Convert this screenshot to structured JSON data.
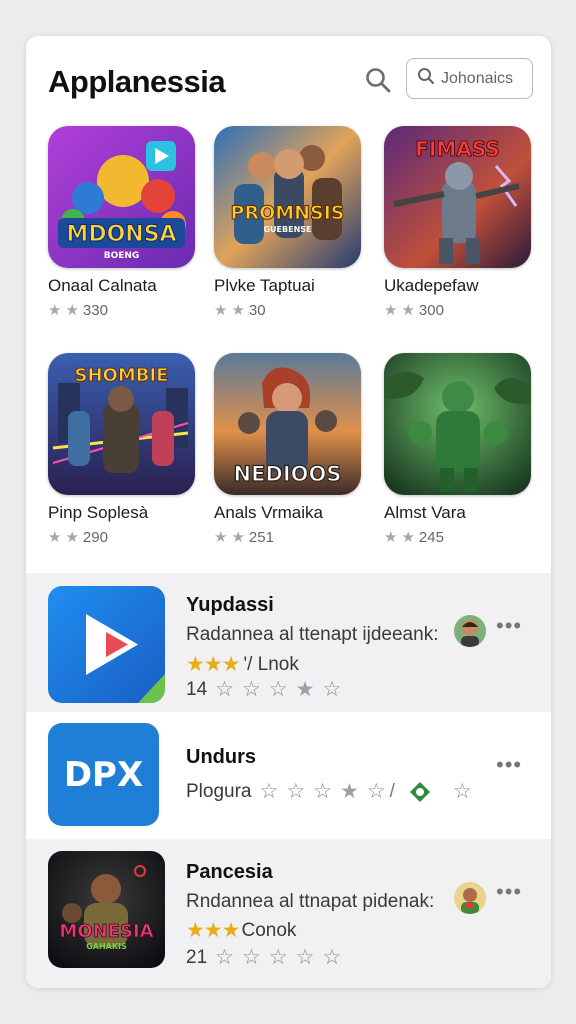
{
  "app": {
    "title": "Applanessia"
  },
  "search": {
    "placeholder": "Johonaics"
  },
  "grid": [
    {
      "name": "Onaal Calnata",
      "rating_count": "330",
      "icon_text": "MDONSA",
      "icon_subtext": "BOENG"
    },
    {
      "name": "Plvke Taptuai",
      "rating_count": "30",
      "icon_text": "PROMNSIS",
      "icon_subtext": "GUEBENSE"
    },
    {
      "name": "Ukadepefaw",
      "rating_count": "300",
      "icon_text": "FIMASS",
      "icon_subtext": ""
    },
    {
      "name": "Pinp Soplesà",
      "rating_count": "290",
      "icon_text": "SHOMBIE",
      "icon_subtext": ""
    },
    {
      "name": "Anals Vrmaika",
      "rating_count": "251",
      "icon_text": "NEDIOOS",
      "icon_subtext": ""
    },
    {
      "name": "Almst Vara",
      "rating_count": "245",
      "icon_text": "",
      "icon_subtext": ""
    }
  ],
  "list": [
    {
      "title": "Yupdassi",
      "desc": "Radannea al ttenapt ijdeeank:",
      "rating_label": "'/ Lnok",
      "count": "14"
    },
    {
      "title": "Undurs",
      "desc": "Plogura",
      "icon_text": "DPX"
    },
    {
      "title": "Pancesia",
      "desc": "Rndannea al ttnapat pidenak:",
      "rating_label": "Conok",
      "count": "21",
      "icon_text": "MONESIA",
      "icon_subtext": "GAHAKIS"
    }
  ],
  "colors": {
    "accent_gold": "#e8ad16",
    "shade": "#f1f1f3",
    "dpx_blue": "#1f7fd6"
  },
  "icons": [
    "search-icon",
    "star-icon",
    "more-icon",
    "play-icon"
  ]
}
